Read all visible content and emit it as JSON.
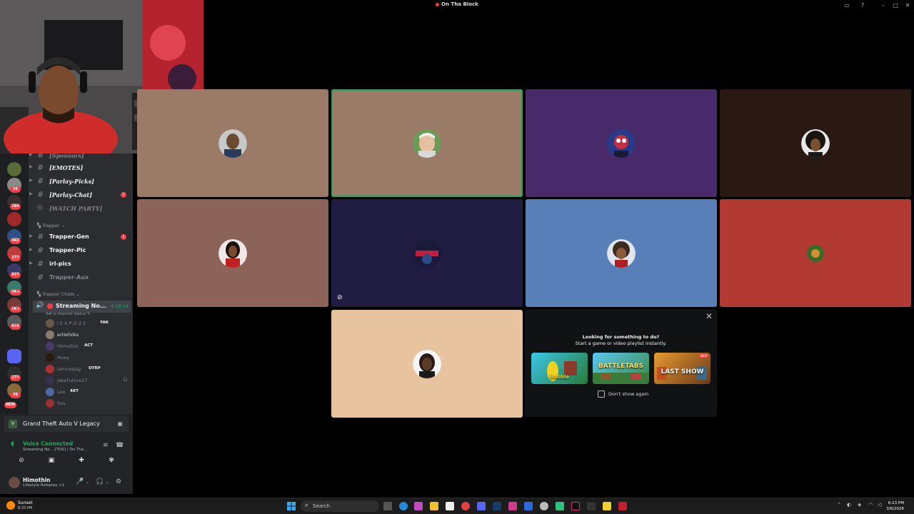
{
  "window": {
    "title": "On Tha Block"
  },
  "server_rail": {
    "badges": [
      "26",
      "164",
      "462",
      "277",
      "927",
      "2K+",
      "1K+",
      "416",
      "177",
      "30",
      "NEW"
    ]
  },
  "channels": {
    "items": [
      {
        "label": "[Sponsors]",
        "style": "italic muted"
      },
      {
        "label": "[EMOTES]",
        "style": "italic"
      },
      {
        "label": "[Parlay-Picks]",
        "style": "italic"
      },
      {
        "label": "[Parlay-Chat]",
        "style": "italic",
        "unread": "1"
      },
      {
        "label": "[WATCH PARTY]",
        "style": "italic muted"
      }
    ],
    "category_trapper": "Trapper ⌄",
    "trapper_items": [
      {
        "label": "Trapper-Gen",
        "unread": "1"
      },
      {
        "label": "Trapper-Pic"
      },
      {
        "label": "irl-pics"
      },
      {
        "label": "Trapper-Aux",
        "muted": true
      }
    ],
    "category_chats": "Trapper Chats ⌄",
    "voice_channel": {
      "label": "Streaming No...",
      "timer": "4:18:24"
    },
    "status_line": "Set a channel status ✎",
    "members": [
      {
        "name": "I E X P O Z E",
        "tag": "YAK",
        "dim": true
      },
      {
        "name": "ertlefolks"
      },
      {
        "name": "Himothin",
        "tag": "ACT",
        "dim": true
      },
      {
        "name": "Huey",
        "dim": true
      },
      {
        "name": "iamceejay.",
        "tag": "OTRP",
        "dim": true
      },
      {
        "name": "JakeFuture27",
        "dim": true
      },
      {
        "name": "Lee",
        "tag": "4KT",
        "dim": true
      },
      {
        "name": "Sos",
        "dim": true
      }
    ]
  },
  "panel": {
    "game": "Grand Theft Auto V Legacy",
    "voice_title": "Voice Connected",
    "voice_sub": "Streaming No... [TOS] / On Tha ...",
    "user_name": "Himothin",
    "user_status": "Lifestyle Roleplay +1"
  },
  "activity": {
    "line1": "Looking for something to do?",
    "line2": "Start a game or video playlist instantly.",
    "cards": [
      "Bobble",
      "BATTLETABS",
      "LAST SHOW"
    ],
    "new_badge": "NEW",
    "checkbox_label": "Don't show again"
  },
  "taskbar": {
    "weather": "Sunset",
    "weather_time": "6:33 PM",
    "search": "Search",
    "time": "6:13 PM",
    "date": "3/6/2026"
  },
  "colors": {
    "tile1": "#9b7b68",
    "tile2": "#9a7b68",
    "tile3": "#482a6a",
    "tile4": "#2a1812",
    "tile5": "#8b6358",
    "tile6": "#211c41",
    "tile7": "#587fb8",
    "tile8": "#b33a33",
    "tile9": "#e8c3a0"
  }
}
